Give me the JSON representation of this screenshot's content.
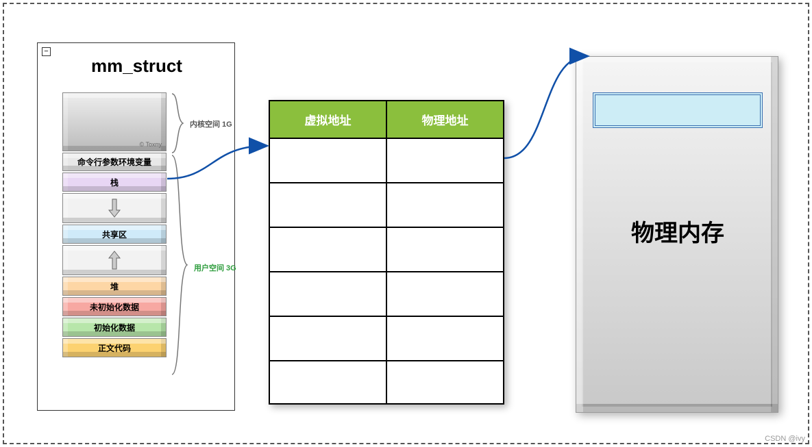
{
  "panel": {
    "collapse_glyph": "−",
    "title": "mm_struct",
    "kernel_watermark": "© Toxny",
    "labels": {
      "cmdline": "命令行参数环境变量",
      "stack": "栈",
      "shared": "共享区",
      "heap": "堆",
      "uninit": "未初始化数据",
      "init": "初始化数据",
      "text": "正文代码"
    },
    "braces": {
      "kernel": "内核空间 1G",
      "user": "用户空间 3G"
    }
  },
  "page_table": {
    "header_virtual": "虚拟地址",
    "header_physical": "物理地址"
  },
  "physical": {
    "title": "物理内存"
  },
  "footer_watermark": "CSDN @ivy"
}
